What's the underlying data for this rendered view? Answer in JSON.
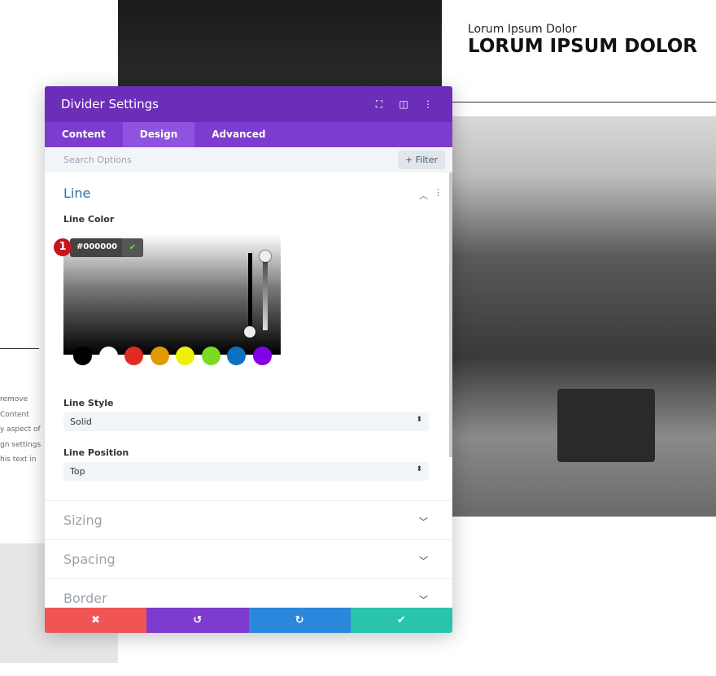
{
  "background": {
    "right_heading_small": "Lorum Ipsum Dolor",
    "right_heading_large": "LORUM IPSUM DOLOR",
    "left_text_lines": [
      "remove",
      "Content",
      "y aspect of",
      "gn settings",
      "his text in"
    ]
  },
  "panel": {
    "title": "Divider Settings",
    "header_icons": [
      "fullscreen-icon",
      "split-view-icon",
      "more-vertical-icon"
    ],
    "tabs": [
      {
        "label": "Content"
      },
      {
        "label": "Design",
        "active": true
      },
      {
        "label": "Advanced"
      }
    ],
    "search_placeholder": "Search Options",
    "filter_label": "+ Filter",
    "line_section": {
      "title": "Line",
      "line_color_label": "Line Color",
      "hex_value": "#000000",
      "badge": "1",
      "swatches": [
        "#000000",
        "#ffffff",
        "#e02b20",
        "#e09900",
        "#edf000",
        "#7cda24",
        "#0c71c3",
        "#8300e9"
      ],
      "line_style_label": "Line Style",
      "line_style_value": "Solid",
      "line_position_label": "Line Position",
      "line_position_value": "Top"
    },
    "collapsed_sections": [
      "Sizing",
      "Spacing",
      "Border"
    ],
    "footer": {
      "cancel_icon": "✖",
      "undo_icon": "↺",
      "redo_icon": "↻",
      "save_icon": "✔"
    },
    "colors": {
      "header": "#6c2eb9",
      "tabs": "#7e3bd0",
      "cancel": "#ef5555",
      "undo": "#7e3bd0",
      "redo": "#2b87da",
      "save": "#29c4a9"
    }
  }
}
